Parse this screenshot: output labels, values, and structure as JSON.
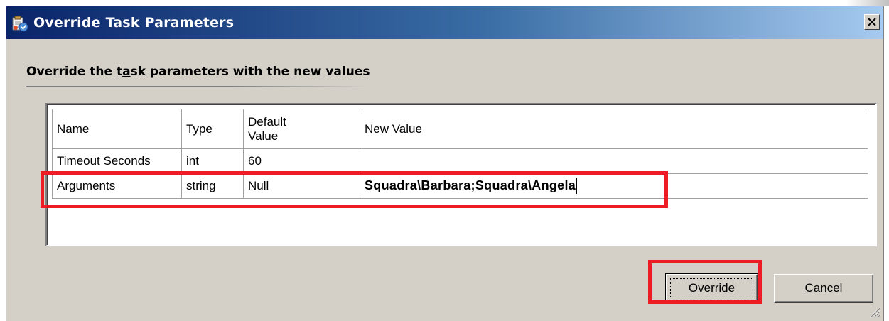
{
  "window": {
    "title": "Override Task Parameters",
    "icon": "task-parameters-icon",
    "close_label": "close-icon"
  },
  "heading": {
    "before": "Override the t",
    "mnemonic": "a",
    "after": "sk parameters with the new values"
  },
  "grid": {
    "columns": [
      "Name",
      "Type",
      "Default Value",
      "New Value"
    ],
    "default_value_lines": [
      "Default",
      "Value"
    ],
    "rows": [
      {
        "name": "Timeout Seconds",
        "type": "int",
        "default": "60",
        "new_value": ""
      },
      {
        "name": "Arguments",
        "type": "string",
        "default": "Null",
        "new_value": "Squadra\\Barbara;Squadra\\Angela"
      }
    ]
  },
  "buttons": {
    "override": {
      "mnemonic": "O",
      "rest": "verride"
    },
    "cancel": "Cancel"
  },
  "colors": {
    "highlight": "#ed1c24",
    "dialog_bg": "#d4d0c8",
    "title_gradient_start": "#0a246a",
    "title_gradient_end": "#a6caf0"
  }
}
